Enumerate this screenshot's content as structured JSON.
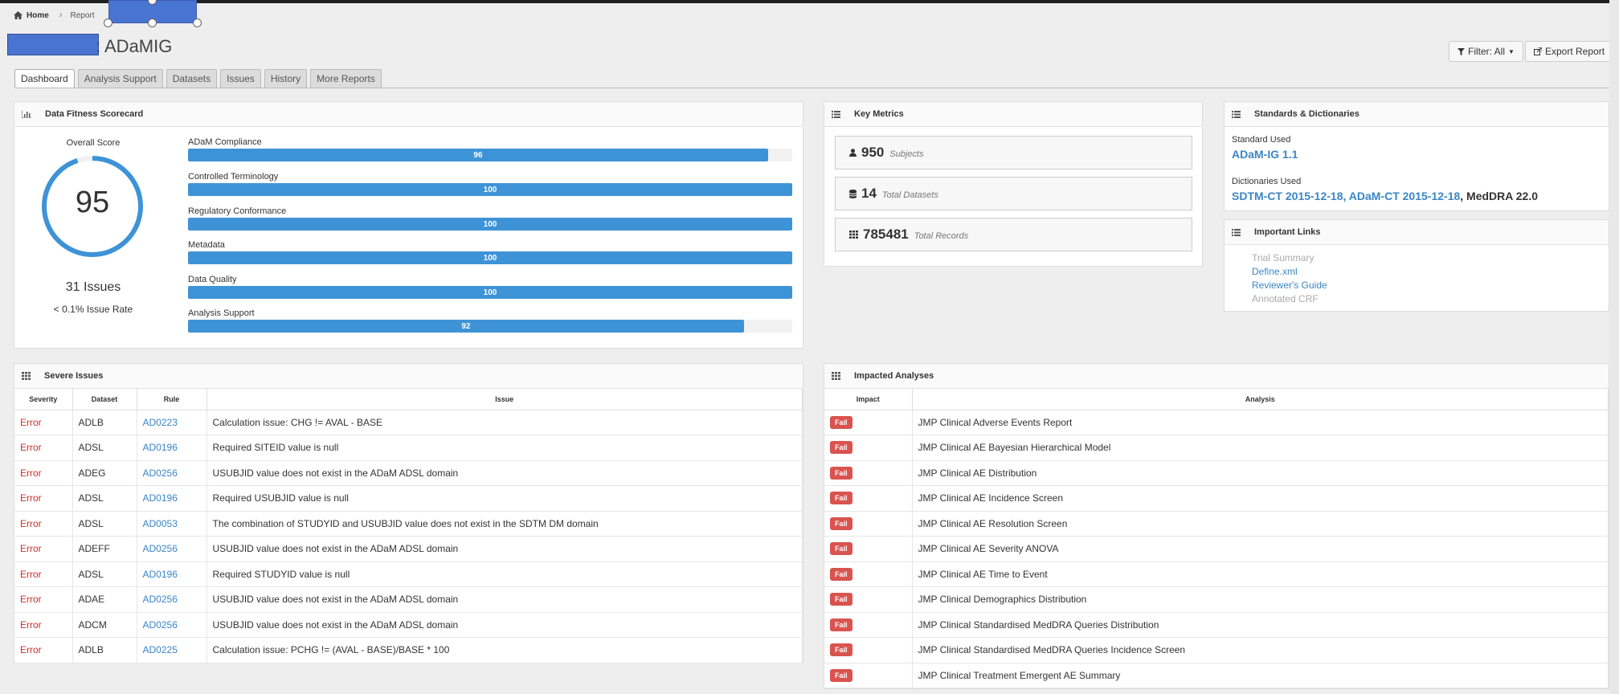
{
  "breadcrumb": {
    "home": "Home",
    "current": "Report"
  },
  "title_suffix": ": ADaMIG",
  "toolbar": {
    "filter_label": "Filter: All",
    "export_label": "Export Report"
  },
  "tabs": [
    "Dashboard",
    "Analysis Support",
    "Datasets",
    "Issues",
    "History",
    "More Reports"
  ],
  "scorecard": {
    "title": "Data Fitness Scorecard",
    "overall_label": "Overall Score",
    "overall_score": "95",
    "issues_count": "31 Issues",
    "issue_rate": "< 0.1% Issue Rate",
    "metrics": [
      {
        "label": "ADaM Compliance",
        "value": 96
      },
      {
        "label": "Controlled Terminology",
        "value": 100
      },
      {
        "label": "Regulatory Conformance",
        "value": 100
      },
      {
        "label": "Metadata",
        "value": 100
      },
      {
        "label": "Data Quality",
        "value": 100
      },
      {
        "label": "Analysis Support",
        "value": 92
      }
    ]
  },
  "key_metrics": {
    "title": "Key Metrics",
    "items": [
      {
        "value": "950",
        "label": "Subjects",
        "icon": "user-icon"
      },
      {
        "value": "14",
        "label": "Total Datasets",
        "icon": "database-icon"
      },
      {
        "value": "785481",
        "label": "Total Records",
        "icon": "grid-icon"
      }
    ]
  },
  "standards": {
    "title": "Standards & Dictionaries",
    "standard_label": "Standard Used",
    "standard_value": "ADaM-IG 1.1",
    "dict_label": "Dictionaries Used",
    "dict_link1": "SDTM-CT 2015-12-18",
    "dict_sep": ", ",
    "dict_link2": "ADaM-CT 2015-12-18",
    "dict_plain": "MedDRA 22.0"
  },
  "important_links": {
    "title": "Important Links",
    "items": [
      "Trial Summary",
      "Define.xml",
      "Reviewer's Guide",
      "Annotated CRF"
    ]
  },
  "severe_issues": {
    "title": "Severe Issues",
    "headers": [
      "Severity",
      "Dataset",
      "Rule",
      "Issue"
    ],
    "rows": [
      [
        "Error",
        "ADLB",
        "AD0223",
        "Calculation issue: CHG != AVAL - BASE"
      ],
      [
        "Error",
        "ADSL",
        "AD0196",
        "Required SITEID value is null"
      ],
      [
        "Error",
        "ADEG",
        "AD0256",
        "USUBJID value does not exist in the ADaM ADSL domain"
      ],
      [
        "Error",
        "ADSL",
        "AD0196",
        "Required USUBJID value is null"
      ],
      [
        "Error",
        "ADSL",
        "AD0053",
        "The combination of STUDYID and USUBJID value does not exist in the SDTM DM domain"
      ],
      [
        "Error",
        "ADEFF",
        "AD0256",
        "USUBJID value does not exist in the ADaM ADSL domain"
      ],
      [
        "Error",
        "ADSL",
        "AD0196",
        "Required STUDYID value is null"
      ],
      [
        "Error",
        "ADAE",
        "AD0256",
        "USUBJID value does not exist in the ADaM ADSL domain"
      ],
      [
        "Error",
        "ADCM",
        "AD0256",
        "USUBJID value does not exist in the ADaM ADSL domain"
      ],
      [
        "Error",
        "ADLB",
        "AD0225",
        "Calculation issue: PCHG != (AVAL - BASE)/BASE * 100"
      ]
    ]
  },
  "impacted": {
    "title": "Impacted Analyses",
    "headers": [
      "Impact",
      "Analysis"
    ],
    "rows": [
      [
        "Fail",
        "JMP Clinical Adverse Events Report"
      ],
      [
        "Fail",
        "JMP Clinical AE Bayesian Hierarchical Model"
      ],
      [
        "Fail",
        "JMP Clinical AE Distribution"
      ],
      [
        "Fail",
        "JMP Clinical AE Incidence Screen"
      ],
      [
        "Fail",
        "JMP Clinical AE Resolution Screen"
      ],
      [
        "Fail",
        "JMP Clinical AE Severity ANOVA"
      ],
      [
        "Fail",
        "JMP Clinical AE Time to Event"
      ],
      [
        "Fail",
        "JMP Clinical Demographics Distribution"
      ],
      [
        "Fail",
        "JMP Clinical Standardised MedDRA Queries Distribution"
      ],
      [
        "Fail",
        "JMP Clinical Standardised MedDRA Queries Incidence Screen"
      ],
      [
        "Fail",
        "JMP Clinical Treatment Emergent AE Summary"
      ]
    ]
  },
  "colors": {
    "accent": "#3e93d7",
    "error": "#c9302c",
    "fail": "#d9534f",
    "redaction": "#4a74d2"
  }
}
